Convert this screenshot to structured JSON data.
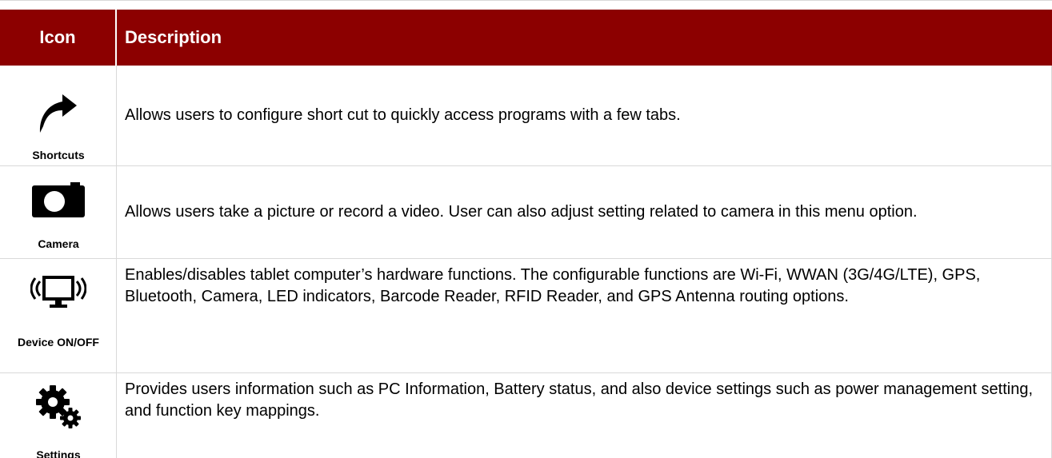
{
  "colors": {
    "header_bg": "#8c0000",
    "header_text": "#ffffff",
    "rule": "#d9d9d9"
  },
  "table": {
    "headers": {
      "icon": "Icon",
      "description": "Description"
    },
    "rows": [
      {
        "icon_name": "shortcut-arrow-icon",
        "label": "Shortcuts",
        "description": "Allows users to configure short cut to quickly access programs with a few tabs."
      },
      {
        "icon_name": "camera-icon",
        "label": "Camera",
        "description": "Allows users take a picture or record a video. User can also adjust setting related to camera in this menu option."
      },
      {
        "icon_name": "monitor-wireless-icon",
        "label": "Device ON/OFF",
        "description": "Enables/disables tablet computer’s hardware functions. The configurable functions are Wi-Fi, WWAN (3G/4G/LTE), GPS, Bluetooth, Camera, LED indicators, Barcode Reader, RFID Reader, and GPS Antenna routing options."
      },
      {
        "icon_name": "gears-icon",
        "label": "Settings",
        "description": "Provides users information such as PC Information, Battery status, and also device settings such as power management setting, and function key mappings."
      }
    ]
  }
}
